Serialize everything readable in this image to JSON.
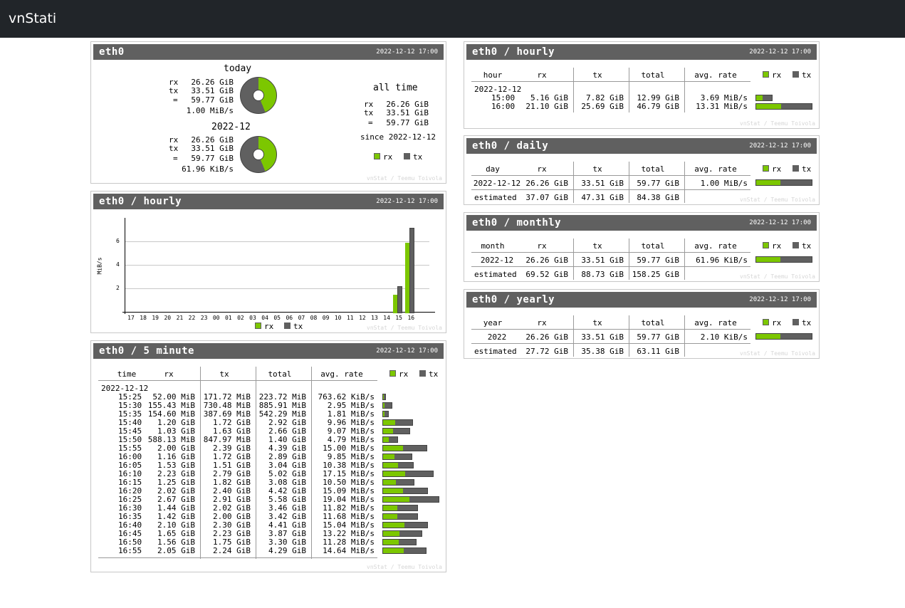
{
  "app": {
    "title": "vnStati"
  },
  "colors": {
    "rx": "#7cc700",
    "tx": "#606060",
    "header": "#606060"
  },
  "credit": "vnStat / Teemu Toivola",
  "legend": {
    "rx": "rx",
    "tx": "tx"
  },
  "summary": {
    "title": "eth0",
    "date": "2022-12-12 17:00",
    "today": {
      "label": "today",
      "rx": "26.26 GiB",
      "tx": "33.51 GiB",
      "total": "59.77 GiB",
      "rate": "1.00 MiB/s",
      "rx_share": 0.44
    },
    "month": {
      "label": "2022-12",
      "rx": "26.26 GiB",
      "tx": "33.51 GiB",
      "total": "59.77 GiB",
      "rate": "61.96 KiB/s",
      "rx_share": 0.44
    },
    "alltime": {
      "label": "all time",
      "rx": "26.26 GiB",
      "tx": "33.51 GiB",
      "total": "59.77 GiB",
      "since": "since 2022-12-12"
    },
    "labels": {
      "rx": "rx",
      "tx": "tx",
      "eq": "="
    }
  },
  "hourly_chart": {
    "title": "eth0 / hourly",
    "date": "2022-12-12 17:00",
    "chart_data": {
      "type": "bar",
      "ylabel": "MiB/s",
      "ylim": [
        0,
        8
      ],
      "yticks": [
        "2",
        "4",
        "6"
      ],
      "categories": [
        "17",
        "18",
        "19",
        "20",
        "21",
        "22",
        "23",
        "00",
        "01",
        "02",
        "03",
        "04",
        "05",
        "06",
        "07",
        "08",
        "09",
        "10",
        "11",
        "12",
        "13",
        "14",
        "15",
        "16"
      ],
      "series": [
        {
          "name": "rx",
          "values": [
            0,
            0,
            0,
            0,
            0,
            0,
            0,
            0,
            0,
            0,
            0,
            0,
            0,
            0,
            0,
            0,
            0,
            0,
            0,
            0,
            0,
            0,
            1.44,
            5.86
          ]
        },
        {
          "name": "tx",
          "values": [
            0,
            0,
            0,
            0,
            0,
            0,
            0,
            0,
            0,
            0,
            0,
            0,
            0,
            0,
            0,
            0,
            0,
            0,
            0,
            0,
            0,
            0,
            2.17,
            7.14
          ]
        }
      ]
    }
  },
  "fivemin": {
    "title": "eth0 / 5 minute",
    "date": "2022-12-12 17:00",
    "headers": [
      "time",
      "rx",
      "tx",
      "total",
      "avg. rate"
    ],
    "group": "2022-12-12",
    "rows": [
      {
        "time": "15:25",
        "rx": "52.00 MiB",
        "tx": "171.72 MiB",
        "total": "223.72 MiB",
        "rate": "763.62 KiB/s",
        "rxv": 0.0508,
        "txv": 0.1677
      },
      {
        "time": "15:30",
        "rx": "155.43 MiB",
        "tx": "730.48 MiB",
        "total": "885.91 MiB",
        "rate": "2.95 MiB/s",
        "rxv": 0.1518,
        "txv": 0.7134
      },
      {
        "time": "15:35",
        "rx": "154.60 MiB",
        "tx": "387.69 MiB",
        "total": "542.29 MiB",
        "rate": "1.81 MiB/s",
        "rxv": 0.151,
        "txv": 0.3786
      },
      {
        "time": "15:40",
        "rx": "1.20 GiB",
        "tx": "1.72 GiB",
        "total": "2.92 GiB",
        "rate": "9.96 MiB/s",
        "rxv": 1.2,
        "txv": 1.72
      },
      {
        "time": "15:45",
        "rx": "1.03 GiB",
        "tx": "1.63 GiB",
        "total": "2.66 GiB",
        "rate": "9.07 MiB/s",
        "rxv": 1.03,
        "txv": 1.63
      },
      {
        "time": "15:50",
        "rx": "588.13 MiB",
        "tx": "847.97 MiB",
        "total": "1.40 GiB",
        "rate": "4.79 MiB/s",
        "rxv": 0.5743,
        "txv": 0.8281
      },
      {
        "time": "15:55",
        "rx": "2.00 GiB",
        "tx": "2.39 GiB",
        "total": "4.39 GiB",
        "rate": "15.00 MiB/s",
        "rxv": 2.0,
        "txv": 2.39
      },
      {
        "time": "16:00",
        "rx": "1.16 GiB",
        "tx": "1.72 GiB",
        "total": "2.89 GiB",
        "rate": "9.85 MiB/s",
        "rxv": 1.16,
        "txv": 1.72
      },
      {
        "time": "16:05",
        "rx": "1.53 GiB",
        "tx": "1.51 GiB",
        "total": "3.04 GiB",
        "rate": "10.38 MiB/s",
        "rxv": 1.53,
        "txv": 1.51
      },
      {
        "time": "16:10",
        "rx": "2.23 GiB",
        "tx": "2.79 GiB",
        "total": "5.02 GiB",
        "rate": "17.15 MiB/s",
        "rxv": 2.23,
        "txv": 2.79
      },
      {
        "time": "16:15",
        "rx": "1.25 GiB",
        "tx": "1.82 GiB",
        "total": "3.08 GiB",
        "rate": "10.50 MiB/s",
        "rxv": 1.25,
        "txv": 1.82
      },
      {
        "time": "16:20",
        "rx": "2.02 GiB",
        "tx": "2.40 GiB",
        "total": "4.42 GiB",
        "rate": "15.09 MiB/s",
        "rxv": 2.02,
        "txv": 2.4
      },
      {
        "time": "16:25",
        "rx": "2.67 GiB",
        "tx": "2.91 GiB",
        "total": "5.58 GiB",
        "rate": "19.04 MiB/s",
        "rxv": 2.67,
        "txv": 2.91
      },
      {
        "time": "16:30",
        "rx": "1.44 GiB",
        "tx": "2.02 GiB",
        "total": "3.46 GiB",
        "rate": "11.82 MiB/s",
        "rxv": 1.44,
        "txv": 2.02
      },
      {
        "time": "16:35",
        "rx": "1.42 GiB",
        "tx": "2.00 GiB",
        "total": "3.42 GiB",
        "rate": "11.68 MiB/s",
        "rxv": 1.42,
        "txv": 2.0
      },
      {
        "time": "16:40",
        "rx": "2.10 GiB",
        "tx": "2.30 GiB",
        "total": "4.41 GiB",
        "rate": "15.04 MiB/s",
        "rxv": 2.1,
        "txv": 2.3
      },
      {
        "time": "16:45",
        "rx": "1.65 GiB",
        "tx": "2.23 GiB",
        "total": "3.87 GiB",
        "rate": "13.22 MiB/s",
        "rxv": 1.65,
        "txv": 2.23
      },
      {
        "time": "16:50",
        "rx": "1.56 GiB",
        "tx": "1.75 GiB",
        "total": "3.30 GiB",
        "rate": "11.28 MiB/s",
        "rxv": 1.56,
        "txv": 1.75
      },
      {
        "time": "16:55",
        "rx": "2.05 GiB",
        "tx": "2.24 GiB",
        "total": "4.29 GiB",
        "rate": "14.64 MiB/s",
        "rxv": 2.05,
        "txv": 2.24
      }
    ]
  },
  "hourly_table": {
    "title": "eth0 / hourly",
    "date": "2022-12-12 17:00",
    "headers": [
      "hour",
      "rx",
      "tx",
      "total",
      "avg. rate"
    ],
    "group": "2022-12-12",
    "rows": [
      {
        "label": "15:00",
        "rx": "5.16 GiB",
        "tx": "7.82 GiB",
        "total": "12.99 GiB",
        "rate": "3.69 MiB/s",
        "rxv": 5.16,
        "txv": 7.82
      },
      {
        "label": "16:00",
        "rx": "21.10 GiB",
        "tx": "25.69 GiB",
        "total": "46.79 GiB",
        "rate": "13.31 MiB/s",
        "rxv": 21.1,
        "txv": 25.69
      }
    ]
  },
  "daily": {
    "title": "eth0 / daily",
    "date": "2022-12-12 17:00",
    "headers": [
      "day",
      "rx",
      "tx",
      "total",
      "avg. rate"
    ],
    "row": {
      "label": "2022-12-12",
      "rx": "26.26 GiB",
      "tx": "33.51 GiB",
      "total": "59.77 GiB",
      "rate": "1.00 MiB/s",
      "rx_share": 0.44
    },
    "estimated": {
      "label": "estimated",
      "rx": "37.07 GiB",
      "tx": "47.31 GiB",
      "total": "84.38 GiB"
    }
  },
  "monthly": {
    "title": "eth0 / monthly",
    "date": "2022-12-12 17:00",
    "headers": [
      "month",
      "rx",
      "tx",
      "total",
      "avg. rate"
    ],
    "row": {
      "label": "2022-12",
      "rx": "26.26 GiB",
      "tx": "33.51 GiB",
      "total": "59.77 GiB",
      "rate": "61.96 KiB/s",
      "rx_share": 0.44
    },
    "estimated": {
      "label": "estimated",
      "rx": "69.52 GiB",
      "tx": "88.73 GiB",
      "total": "158.25 GiB"
    }
  },
  "yearly": {
    "title": "eth0 / yearly",
    "date": "2022-12-12 17:00",
    "headers": [
      "year",
      "rx",
      "tx",
      "total",
      "avg. rate"
    ],
    "row": {
      "label": "2022",
      "rx": "26.26 GiB",
      "tx": "33.51 GiB",
      "total": "59.77 GiB",
      "rate": "2.10 KiB/s",
      "rx_share": 0.44
    },
    "estimated": {
      "label": "estimated",
      "rx": "27.72 GiB",
      "tx": "35.38 GiB",
      "total": "63.11 GiB"
    }
  }
}
